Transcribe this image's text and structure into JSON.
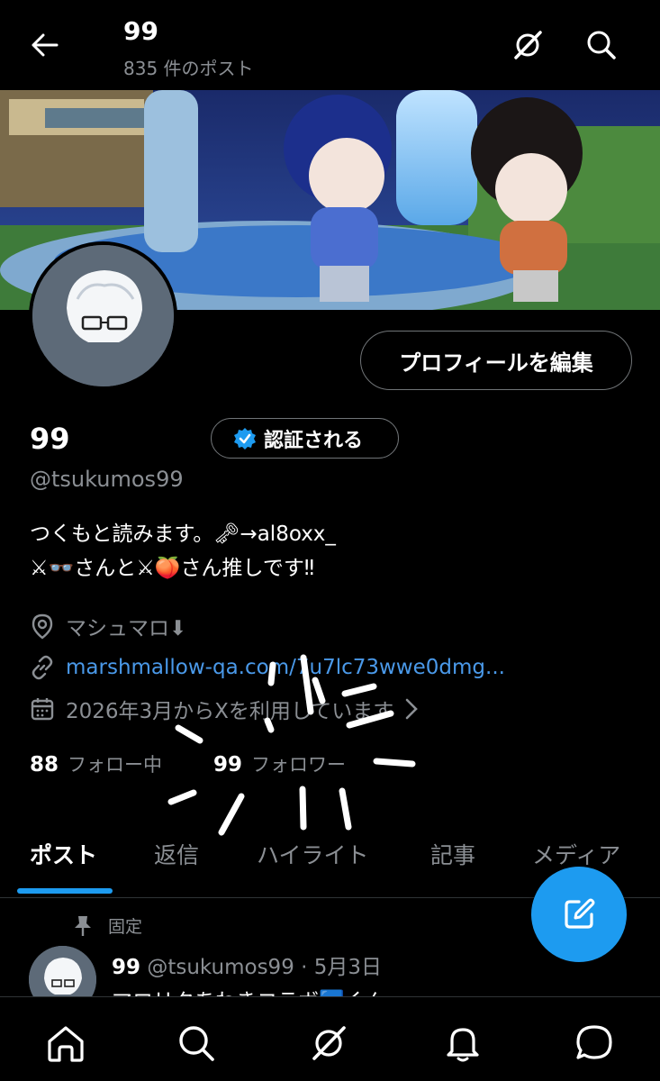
{
  "header": {
    "title": "99",
    "post_count": "835 件のポスト"
  },
  "profile": {
    "edit_button": "プロフィールを編集",
    "name": "99",
    "verify_button": "認証される",
    "handle": "@tsukumos99",
    "bio_line1": "つくもと読みます。🗝→al8oxx_",
    "bio_line2": "⚔👓さんと⚔🍑さん推しです‼",
    "location": "マシュマロ⬇",
    "url": "marshmallow-qa.com/7u7lc73wwe0dmg...",
    "joined": "2026年3月からXを利用しています"
  },
  "stats": {
    "following_count": "88",
    "following_label": "フォロー中",
    "followers_count": "99",
    "followers_label": "フォロワー"
  },
  "tabs": [
    {
      "label": "ポスト",
      "active": true
    },
    {
      "label": "返信",
      "active": false
    },
    {
      "label": "ハイライト",
      "active": false
    },
    {
      "label": "記事",
      "active": false
    },
    {
      "label": "メディア",
      "active": false
    }
  ],
  "pinned_post": {
    "pin_label": "固定",
    "author": "99",
    "handle_date": "@tsukumos99 · 5月3日",
    "text": "マロリクあわきコラボ🟦くん"
  },
  "colors": {
    "accent": "#1d9bf0",
    "link": "#4a99e9",
    "muted": "#8b8f94",
    "background": "#000000"
  },
  "icons": {
    "header": [
      "back-arrow-icon",
      "grok-icon",
      "search-icon"
    ],
    "bottom_nav": [
      "home-icon",
      "search-icon",
      "grok-icon",
      "bell-icon",
      "chat-icon"
    ]
  }
}
